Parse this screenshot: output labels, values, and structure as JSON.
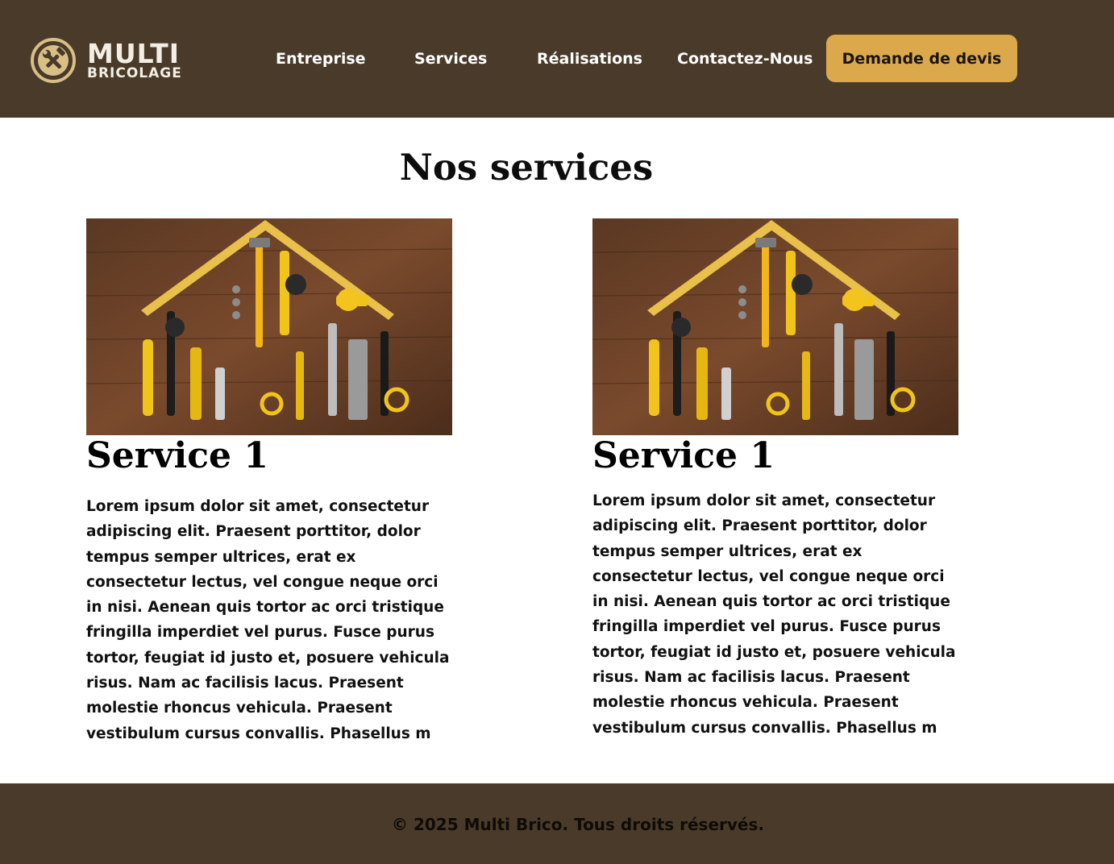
{
  "header": {
    "logo": {
      "line1": "MULTI",
      "line2": "BRICOLAGE",
      "icon": "hammer-wrench-icon"
    },
    "nav": [
      {
        "label": "Entreprise"
      },
      {
        "label": "Services"
      },
      {
        "label": "Réalisations"
      },
      {
        "label": "Contactez-Nous"
      }
    ],
    "cta_label": "Demande de devis"
  },
  "main": {
    "title": "Nos services",
    "services": [
      {
        "title": "Service 1",
        "image": "tools-house-image",
        "text": "Lorem ipsum dolor sit amet, consectetur adipiscing elit. Praesent porttitor, dolor tempus semper ultrices, erat ex consectetur lectus, vel congue neque orci in nisi. Aenean quis tortor ac orci tristique fringilla imperdiet vel purus. Fusce purus tortor, feugiat id justo et, posuere vehicula risus. Nam ac facilisis lacus. Praesent molestie rhoncus vehicula. Praesent vestibulum cursus convallis. Phasellus m"
      },
      {
        "title": "Service 1",
        "image": "tools-house-image",
        "text": "Lorem ipsum dolor sit amet, consectetur adipiscing elit. Praesent porttitor, dolor tempus semper ultrices, erat ex consectetur lectus, vel congue neque orci in nisi. Aenean quis tortor ac orci tristique fringilla imperdiet vel purus. Fusce purus tortor, feugiat id justo et, posuere vehicula risus. Nam ac facilisis lacus. Praesent molestie rhoncus vehicula. Praesent vestibulum cursus convallis. Phasellus m"
      }
    ]
  },
  "footer": {
    "copyright": "© 2025 Multi Brico. Tous droits réservés."
  },
  "colors": {
    "header_bg": "#4a3a2a",
    "accent": "#dba94b",
    "logo": "#d8bf86"
  }
}
